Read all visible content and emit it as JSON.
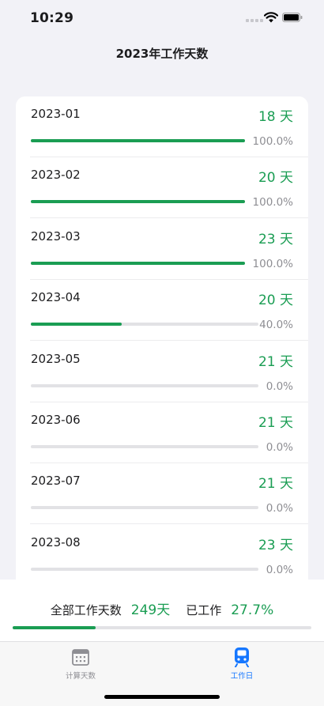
{
  "status": {
    "time": "10:29"
  },
  "page_title": "2023年工作天数",
  "months": [
    {
      "month": "2023-01",
      "days": "18 天",
      "percent_text": "100.0%",
      "progress": 1.0
    },
    {
      "month": "2023-02",
      "days": "20 天",
      "percent_text": "100.0%",
      "progress": 1.0
    },
    {
      "month": "2023-03",
      "days": "23 天",
      "percent_text": "100.0%",
      "progress": 1.0
    },
    {
      "month": "2023-04",
      "days": "20 天",
      "percent_text": "40.0%",
      "progress": 0.4
    },
    {
      "month": "2023-05",
      "days": "21 天",
      "percent_text": "0.0%",
      "progress": 0.0
    },
    {
      "month": "2023-06",
      "days": "21 天",
      "percent_text": "0.0%",
      "progress": 0.0
    },
    {
      "month": "2023-07",
      "days": "21 天",
      "percent_text": "0.0%",
      "progress": 0.0
    },
    {
      "month": "2023-08",
      "days": "23 天",
      "percent_text": "0.0%",
      "progress": 0.0
    }
  ],
  "summary": {
    "total_label": "全部工作天数",
    "total_value": "249天",
    "worked_label": "已工作",
    "worked_value": "27.7%",
    "progress": 0.277
  },
  "tabs": [
    {
      "label": "计算天数",
      "icon": "calendar-icon",
      "active": false
    },
    {
      "label": "工作日",
      "icon": "train-icon",
      "active": true
    }
  ],
  "colors": {
    "accent": "#1a9d53",
    "active_tab": "#1677ff",
    "inactive_tab": "#8e8e93"
  }
}
